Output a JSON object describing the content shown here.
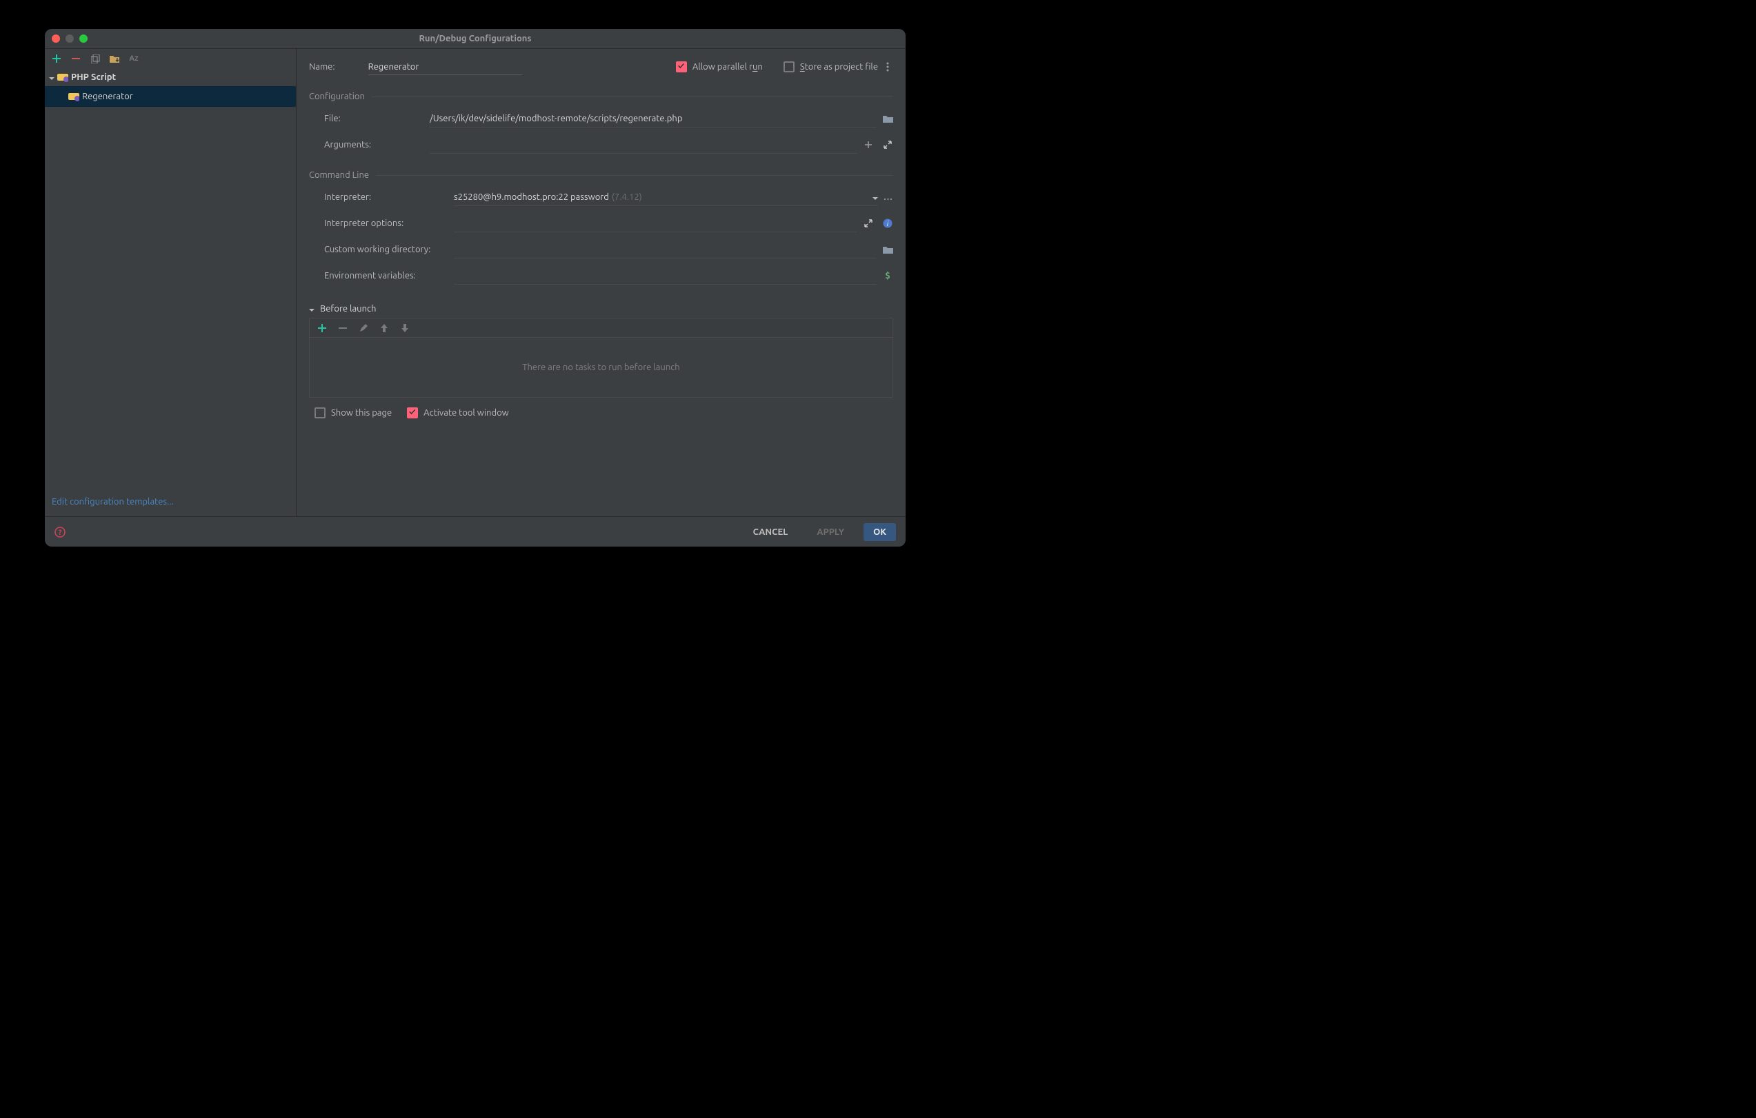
{
  "title": "Run/Debug Configurations",
  "sidebar": {
    "group": "PHP Script",
    "item": "Regenerator",
    "edit_templates": "Edit configuration templates..."
  },
  "name": {
    "label": "Name:",
    "value": "Regenerator"
  },
  "allow_parallel": {
    "label_pre": "Allow parallel r",
    "label_u": "u",
    "label_post": "n",
    "checked": true
  },
  "store_project": {
    "label_u": "S",
    "label_post": "tore as project file",
    "checked": false
  },
  "sections": {
    "configuration": "Configuration",
    "command_line": "Command Line",
    "before_launch": "Before launch"
  },
  "fields": {
    "file": {
      "label": "File:",
      "value": "/Users/ik/dev/sidelife/modhost-remote/scripts/regenerate.php"
    },
    "arguments": {
      "label": "Arguments:",
      "value": ""
    },
    "interpreter": {
      "label": "Interpreter:",
      "value": "s25280@h9.modhost.pro:22 password",
      "version": "(7.4.12)"
    },
    "interpreter_options": {
      "label": "Interpreter options:",
      "value": ""
    },
    "cwd": {
      "label": "Custom working directory:",
      "value": ""
    },
    "env": {
      "label": "Environment variables:",
      "value": ""
    }
  },
  "tasks_empty": "There are no tasks to run before launch",
  "show_this_page": {
    "label": "Show this page",
    "checked": false
  },
  "activate_tool": {
    "label": "Activate tool window",
    "checked": true
  },
  "buttons": {
    "cancel": "CANCEL",
    "apply": "APPLY",
    "ok": "OK"
  }
}
